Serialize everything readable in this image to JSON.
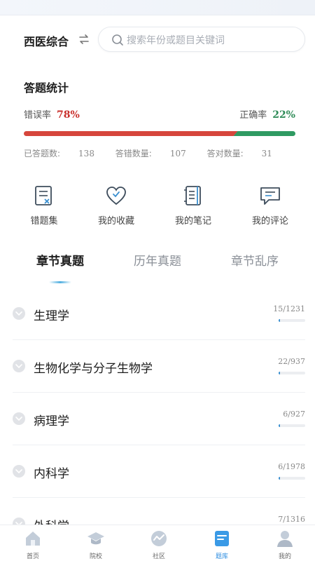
{
  "header": {
    "subject": "西医综合",
    "switch_icon": "switch-arrows-icon",
    "search_placeholder": "搜索年份或题目关键词"
  },
  "stats": {
    "title": "答题统计",
    "wrong_rate_label": "错误率",
    "wrong_rate": "78%",
    "wrong_rate_value": 78,
    "correct_rate_label": "正确率",
    "correct_rate": "22%",
    "correct_rate_value": 22,
    "wrong_color": "#d6463c",
    "correct_color": "#2f9a62",
    "answered_label": "已答题数:",
    "answered_count": "138",
    "wrong_count_label": "答错数量:",
    "wrong_count": "107",
    "right_count_label": "答对数量:",
    "right_count": "31"
  },
  "tools": [
    {
      "label": "错题集",
      "icon": "wrong-set-icon"
    },
    {
      "label": "我的收藏",
      "icon": "heart-icon"
    },
    {
      "label": "我的笔记",
      "icon": "notebook-icon"
    },
    {
      "label": "我的评论",
      "icon": "comment-icon"
    }
  ],
  "tabs": [
    {
      "label": "章节真题",
      "active": true
    },
    {
      "label": "历年真题",
      "active": false
    },
    {
      "label": "章节乱序",
      "active": false
    }
  ],
  "chapters": [
    {
      "name": "生理学",
      "progress": "15/1231",
      "fraction": 0.012
    },
    {
      "name": "生物化学与分子生物学",
      "progress": "22/937",
      "fraction": 0.023
    },
    {
      "name": "病理学",
      "progress": "6/927",
      "fraction": 0.006
    },
    {
      "name": "内科学",
      "progress": "6/1978",
      "fraction": 0.003
    },
    {
      "name": "外科学",
      "progress": "7/1316",
      "fraction": 0.005
    }
  ],
  "tabbar": [
    {
      "label": "首页",
      "icon": "home-icon",
      "active": false
    },
    {
      "label": "院校",
      "icon": "graduation-cap-icon",
      "active": false
    },
    {
      "label": "社区",
      "icon": "community-icon",
      "active": false
    },
    {
      "label": "题库",
      "icon": "question-bank-icon",
      "active": true
    },
    {
      "label": "我的",
      "icon": "profile-icon",
      "active": false
    }
  ],
  "colors": {
    "accent_blue": "#2f8ee0",
    "tab_underline": "#52b0e0"
  }
}
